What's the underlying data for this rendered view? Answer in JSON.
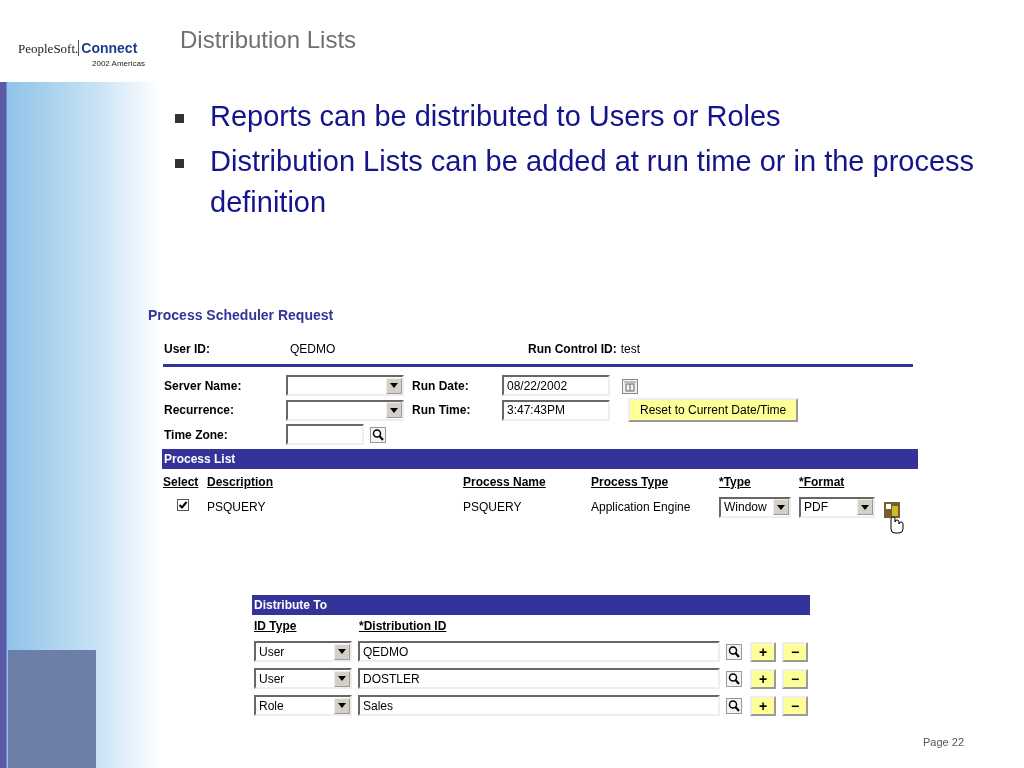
{
  "logo": {
    "brand": "PeopleSoft.",
    "product": "Connect",
    "edition": "2002 Americas"
  },
  "title": "Distribution Lists",
  "bullets": [
    {
      "text": "Reports can be distributed to Users or Roles"
    },
    {
      "text": "Distribution Lists can be added at run time or in the process definition"
    }
  ],
  "scheduler": {
    "title": "Process Scheduler Request",
    "user_id_label": "User ID:",
    "user_id": "QEDMO",
    "run_control_label": "Run Control ID:",
    "run_control": "test",
    "server_name_label": "Server Name:",
    "recurrence_label": "Recurrence:",
    "time_zone_label": "Time Zone:",
    "run_date_label": "Run Date:",
    "run_date": "08/22/2002",
    "run_time_label": "Run Time:",
    "run_time": "3:47:43PM",
    "reset_button": "Reset to Current Date/Time",
    "process_list": {
      "title": "Process List",
      "columns": [
        "Select",
        "Description",
        "Process Name",
        "Process Type",
        "*Type",
        "*Format"
      ],
      "rows": [
        {
          "checked": true,
          "description": "PSQUERY",
          "process_name": "PSQUERY",
          "process_type": "Application Engine",
          "type": "Window",
          "format": "PDF"
        }
      ]
    }
  },
  "distribute_to": {
    "title": "Distribute To",
    "columns": [
      "ID Type",
      "*Distribution ID"
    ],
    "rows": [
      {
        "id_type": "User",
        "distribution_id": "QEDMO",
        "add": "+",
        "remove": "−"
      },
      {
        "id_type": "User",
        "distribution_id": "DOSTLER",
        "add": "+",
        "remove": "−"
      },
      {
        "id_type": "Role",
        "distribution_id": "Sales",
        "add": "+",
        "remove": "−"
      }
    ]
  },
  "page": "Page 22"
}
